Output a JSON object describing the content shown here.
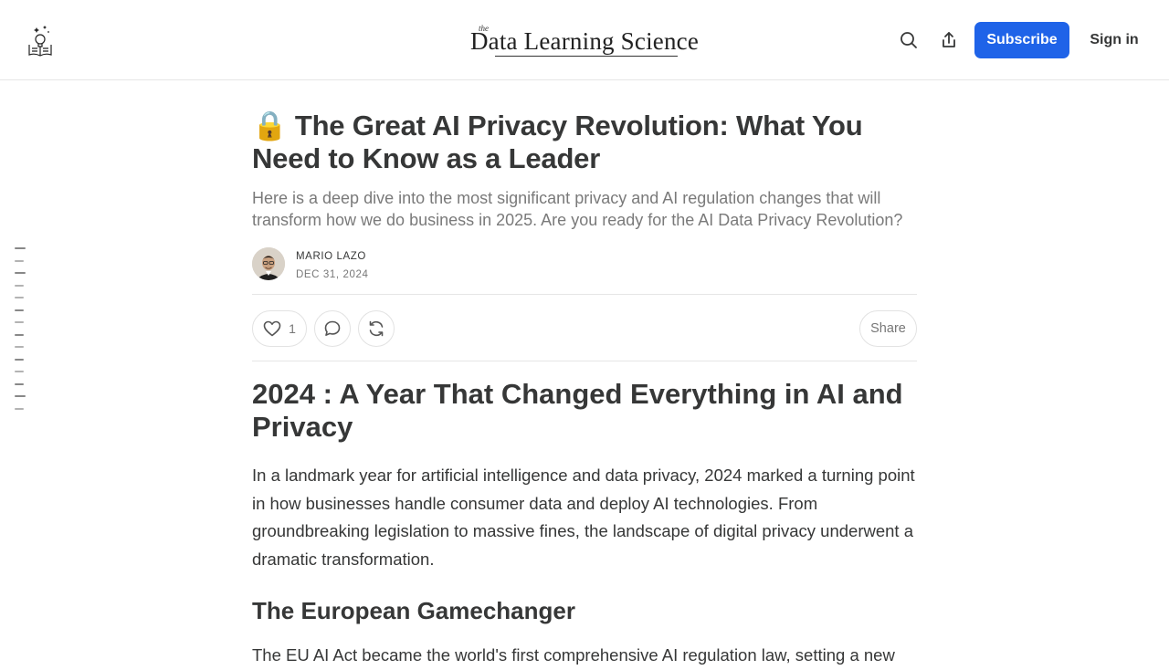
{
  "header": {
    "wordmark_small": "the",
    "wordmark": "Data Learning Science",
    "subscribe_label": "Subscribe",
    "signin_label": "Sign in",
    "icons": {
      "logo": "book-lightbulb-icon",
      "search": "search-icon",
      "share": "share-upload-icon"
    },
    "accent_color": "#1f63e8"
  },
  "toc": {
    "item_count": 14
  },
  "post": {
    "title_emoji": "🔒",
    "title": "The Great AI Privacy Revolution: What You Need to Know as a Leader",
    "subtitle": "Here is a deep dive into the most significant privacy and AI regulation changes that will transform how we do business in 2025. Are you ready for the AI Data Privacy Revolution?",
    "author": "MARIO LAZO",
    "date": "DEC 31, 2024"
  },
  "actions": {
    "like_count": "1",
    "share_label": "Share",
    "icons": {
      "like": "heart-icon",
      "comment": "comment-bubble-icon",
      "restack": "restack-icon"
    }
  },
  "body": {
    "h2": "2024 : A Year That Changed Everything in AI and Privacy",
    "p1": "In a landmark year for artificial intelligence and data privacy, 2024 marked a turning point in how businesses handle consumer data and deploy AI technologies. From groundbreaking legislation to massive fines, the landscape of digital privacy underwent a dramatic transformation.",
    "h3": "The European Gamechanger",
    "p2": "The EU AI Act became the world's first comprehensive AI regulation law, setting a new"
  }
}
